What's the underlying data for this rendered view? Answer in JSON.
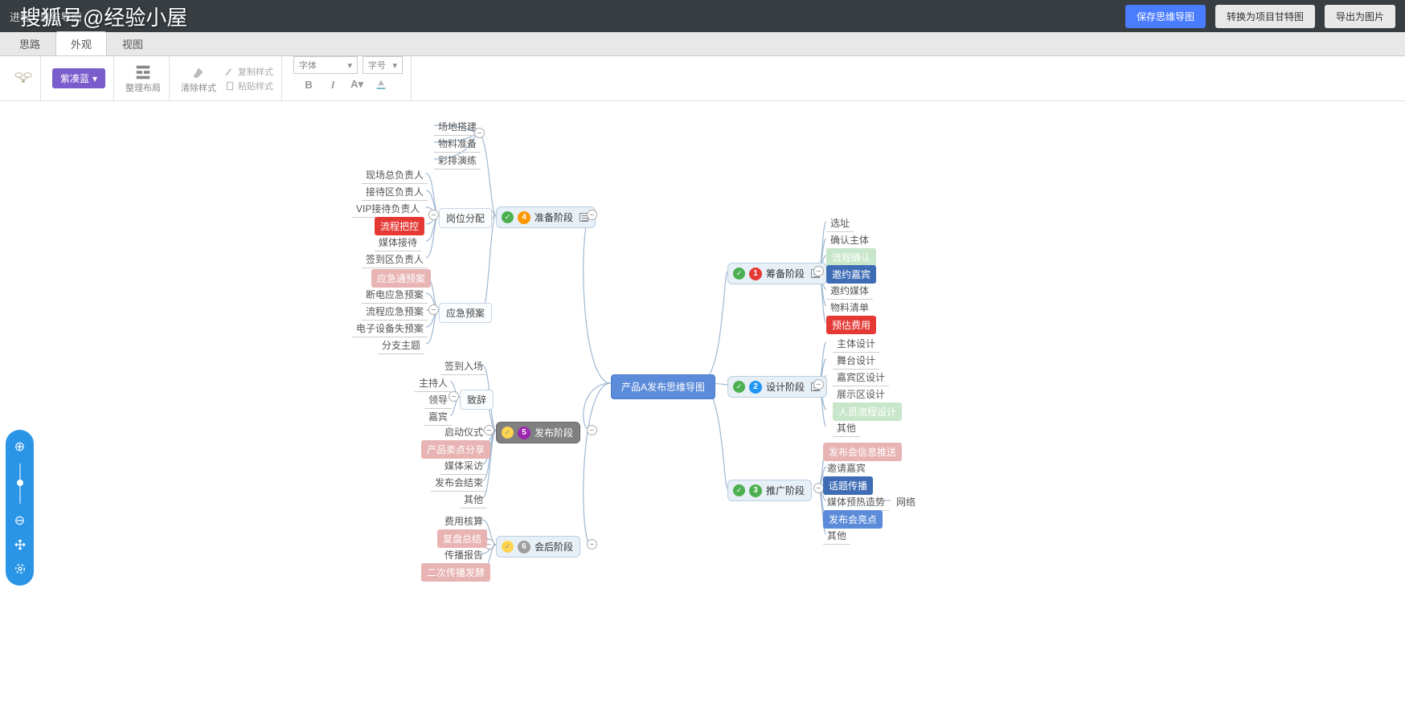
{
  "watermark": "搜狐号@经验小屋",
  "header": {
    "title": "进程 · 思维导图",
    "save": "保存思维导图",
    "convert": "转换为项目甘特图",
    "export": "导出为图片"
  },
  "tabs": {
    "t1": "思路",
    "t2": "外观",
    "t3": "视图"
  },
  "toolbar": {
    "theme": "紫凑蓝",
    "layout": "整理布局",
    "clear": "清除样式",
    "copy": "复制样式",
    "paste": "粘贴样式",
    "font": "字体",
    "size": "字号"
  },
  "root": "产品A发布思维导图",
  "right": {
    "n1": {
      "label": "筹备阶段",
      "num": "1",
      "items": [
        "选址",
        "确认主体",
        "流程确认",
        "邀约嘉宾",
        "邀约媒体",
        "物料清单",
        "预估费用"
      ]
    },
    "n2": {
      "label": "设计阶段",
      "num": "2",
      "items": [
        "主体设计",
        "舞台设计",
        "嘉宾区设计",
        "展示区设计",
        "人员流程设计",
        "其他"
      ]
    },
    "n3": {
      "label": "推广阶段",
      "num": "3",
      "items": [
        "发布会信息推送",
        "邀请嘉宾",
        "话题传播",
        "媒体预热造势",
        "发布会亮点",
        "其他"
      ],
      "extra": "网络"
    }
  },
  "left": {
    "n4": {
      "label": "准备阶段",
      "num": "4",
      "sub1": {
        "label": "岗位分配",
        "items": [
          "现场总负责人",
          "接待区负责人",
          "VIP接待负责人",
          "流程把控",
          "媒体接待",
          "签到区负责人"
        ]
      },
      "sub1a": {
        "items": [
          "场地搭建",
          "物料准备",
          "彩排演练"
        ]
      },
      "sub2": {
        "label": "应急预案",
        "items": [
          "应急通预案",
          "断电应急预案",
          "流程应急预案",
          "电子设备失预案",
          "分支主题"
        ]
      }
    },
    "n5": {
      "label": "发布阶段",
      "num": "5",
      "items": [
        "签到入场",
        "致辞",
        "启动仪式",
        "产品卖点分享",
        "媒体采访",
        "发布会结束",
        "其他"
      ],
      "sub": {
        "label": "致辞",
        "items": [
          "主持人",
          "领导",
          "嘉宾"
        ]
      }
    },
    "n6": {
      "label": "会后阶段",
      "num": "6",
      "items": [
        "费用核算",
        "复盘总结",
        "传播报告",
        "二次传播发酵"
      ]
    }
  },
  "zoom": {
    "plus": "⊕",
    "minus": "⊖"
  }
}
